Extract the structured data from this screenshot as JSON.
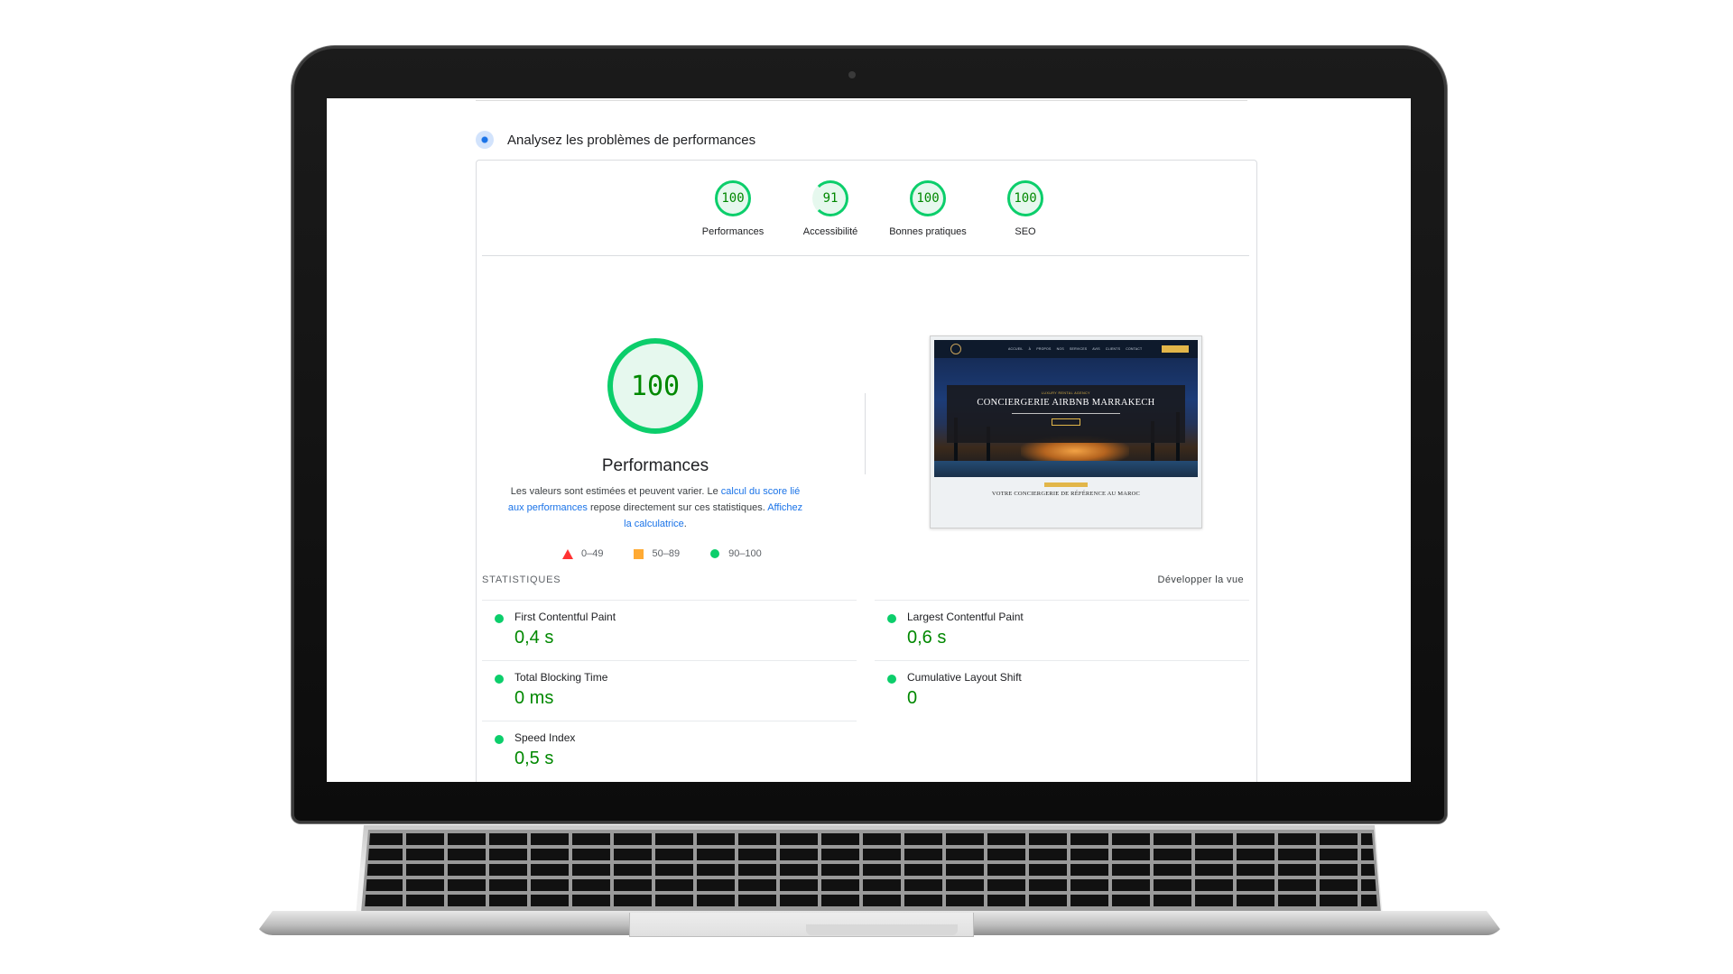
{
  "header": {
    "title": "Analysez les problèmes de performances",
    "icon": "lighthouse-icon"
  },
  "categories": [
    {
      "score": "100",
      "label": "Performances"
    },
    {
      "score": "91",
      "label": "Accessibilité"
    },
    {
      "score": "100",
      "label": "Bonnes pratiques"
    },
    {
      "score": "100",
      "label": "SEO"
    }
  ],
  "main_gauge": {
    "score": "100",
    "title": "Performances",
    "explain_1": "Les valeurs sont estimées et peuvent varier. Le ",
    "link_1": "calcul du score lié aux performances",
    "explain_2": " repose directement sur ces statistiques. ",
    "link_2": "Affichez la calculatrice",
    "explain_3": "."
  },
  "legend": [
    {
      "range": "0–49",
      "color": "#ff3333"
    },
    {
      "range": "50–89",
      "color": "#ffaa33"
    },
    {
      "range": "90–100",
      "color": "#0cce6b"
    }
  ],
  "screenshot": {
    "nav": "ACCUEIL  À PROPOS  NOS SERVICES  AVIS CLIENTS  CONTACT",
    "tag": "LUXURY RENTAL AGENCY",
    "headline": "CONCIERGERIE AIRBNB MARRAKECH",
    "subheadline": "VOTRE CONCIERGERIE DE RÉFÉRENCE AU MAROC"
  },
  "stats": {
    "label": "STATISTIQUES",
    "expand": "Développer la vue",
    "left": [
      {
        "name": "First Contentful Paint",
        "value": "0,4 s"
      },
      {
        "name": "Total Blocking Time",
        "value": "0 ms"
      },
      {
        "name": "Speed Index",
        "value": "0,5 s"
      }
    ],
    "right": [
      {
        "name": "Largest Contentful Paint",
        "value": "0,6 s"
      },
      {
        "name": "Cumulative Layout Shift",
        "value": "0"
      }
    ]
  },
  "colors": {
    "pass": "#0cce6b",
    "pass_text": "#008800",
    "link": "#1a73e8"
  }
}
